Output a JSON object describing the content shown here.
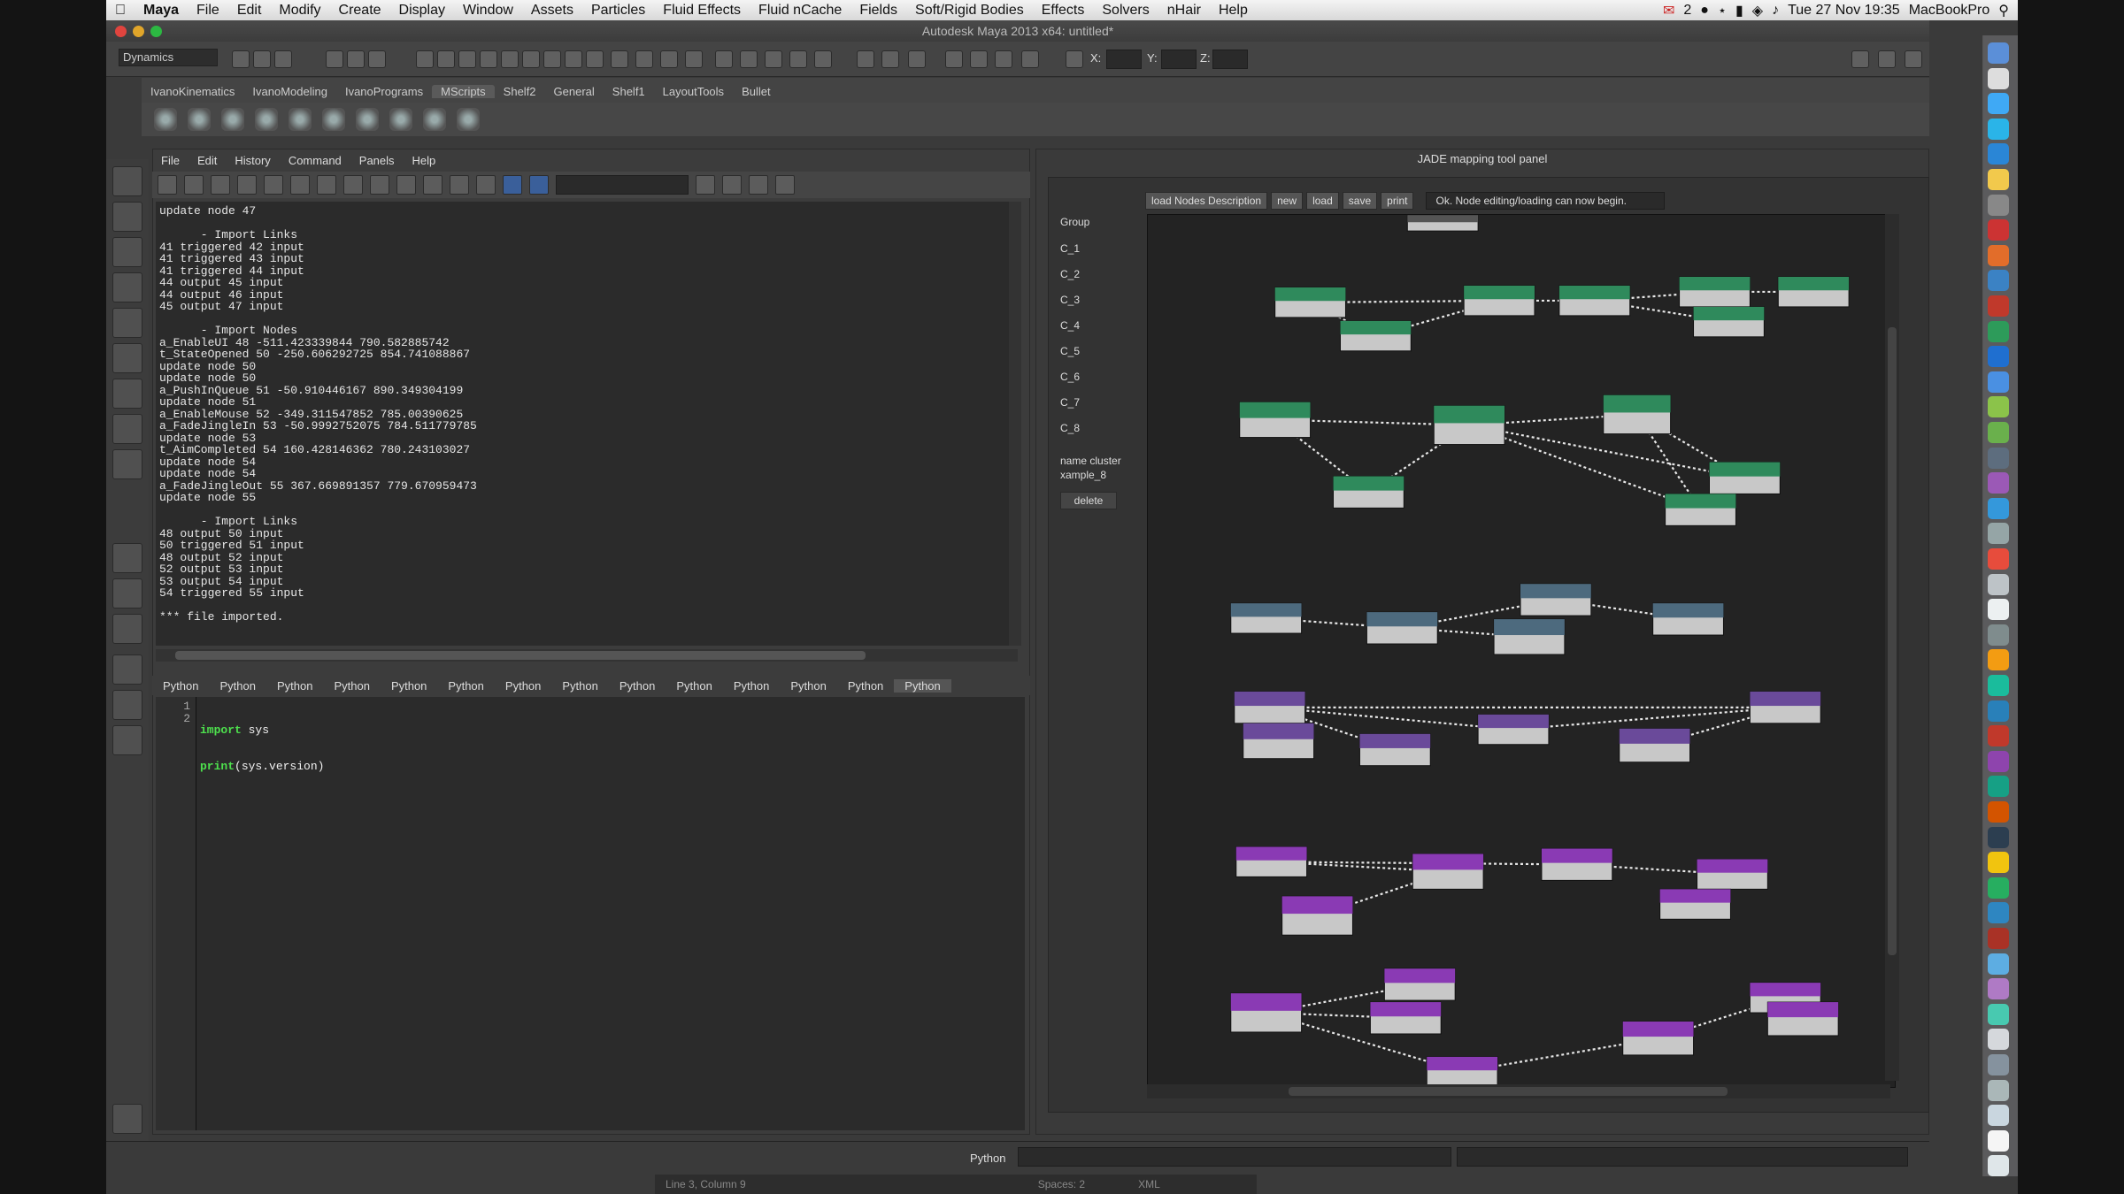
{
  "mac_menubar": {
    "app": "Maya",
    "items": [
      "File",
      "Edit",
      "Modify",
      "Create",
      "Display",
      "Window",
      "Assets",
      "Particles",
      "Fluid Effects",
      "Fluid nCache",
      "Fields",
      "Soft/Rigid Bodies",
      "Effects",
      "Solvers",
      "nHair",
      "Help"
    ],
    "mail_count": "2",
    "clock": "Tue 27 Nov  19:35",
    "machine": "MacBookPro"
  },
  "window": {
    "title": "Autodesk Maya 2013 x64: untitled*"
  },
  "status_line": {
    "mode": "Dynamics",
    "coord_labels": [
      "X:",
      "Y:",
      "Z:"
    ]
  },
  "shelf": {
    "tabs": [
      "IvanoKinematics",
      "IvanoModeling",
      "IvanoPrograms",
      "MScripts",
      "Shelf2",
      "General",
      "Shelf1",
      "LayoutTools",
      "Bullet"
    ],
    "active_tab": "MScripts"
  },
  "script_editor": {
    "menu": [
      "File",
      "Edit",
      "History",
      "Command",
      "Panels",
      "Help"
    ],
    "history_lines": [
      "update node 47",
      "",
      "      - Import Links",
      "41 triggered 42 input",
      "41 triggered 43 input",
      "41 triggered 44 input",
      "44 output 45 input",
      "44 output 46 input",
      "45 output 47 input",
      "",
      "      - Import Nodes",
      "a_EnableUI 48 -511.423339844 790.582885742",
      "t_StateOpened 50 -250.606292725 854.741088867",
      "update node 50",
      "update node 50",
      "a_PushInQueue 51 -50.910446167 890.349304199",
      "update node 51",
      "a_EnableMouse 52 -349.311547852 785.00390625",
      "a_FadeJingleIn 53 -50.9992752075 784.511779785",
      "update node 53",
      "t_AimCompleted 54 160.428146362 780.243103027",
      "update node 54",
      "update node 54",
      "a_FadeJingleOut 55 367.669891357 779.670959473",
      "update node 55",
      "",
      "      - Import Links",
      "48 output 50 input",
      "50 triggered 51 input",
      "48 output 52 input",
      "52 output 53 input",
      "53 output 54 input",
      "54 triggered 55 input",
      "",
      "*** file imported."
    ],
    "tabs": [
      "Python",
      "Python",
      "Python",
      "Python",
      "Python",
      "Python",
      "Python",
      "Python",
      "Python",
      "Python",
      "Python",
      "Python",
      "Python",
      "Python"
    ],
    "code": {
      "line_numbers": [
        "1",
        "2"
      ],
      "line1_kw": "import",
      "line1_rest": " sys",
      "line2_kw": "print",
      "line2_rest": "(sys.version)"
    }
  },
  "command_line": {
    "language": "Python"
  },
  "status_bar": {
    "position": "Line 3, Column 9",
    "spaces": "Spaces: 2",
    "syntax": "XML"
  },
  "jade": {
    "title": "JADE mapping tool panel",
    "buttons": [
      "load Nodes Description",
      "new",
      "load",
      "save",
      "print"
    ],
    "message": "Ok. Node editing/loading can now begin.",
    "group_label": "Group",
    "groups": [
      "C_1",
      "C_2",
      "C_3",
      "C_4",
      "C_5",
      "C_6",
      "C_7",
      "C_8"
    ],
    "name_cluster_label": "name cluster",
    "name_cluster_value": "xample_8",
    "delete_label": "delete"
  },
  "colors": {
    "green": "#2f8a5c",
    "steel": "#4d6a7e",
    "violet": "#6a4a9a",
    "magenta": "#8a3ab4",
    "keyword": "#4de04d"
  }
}
